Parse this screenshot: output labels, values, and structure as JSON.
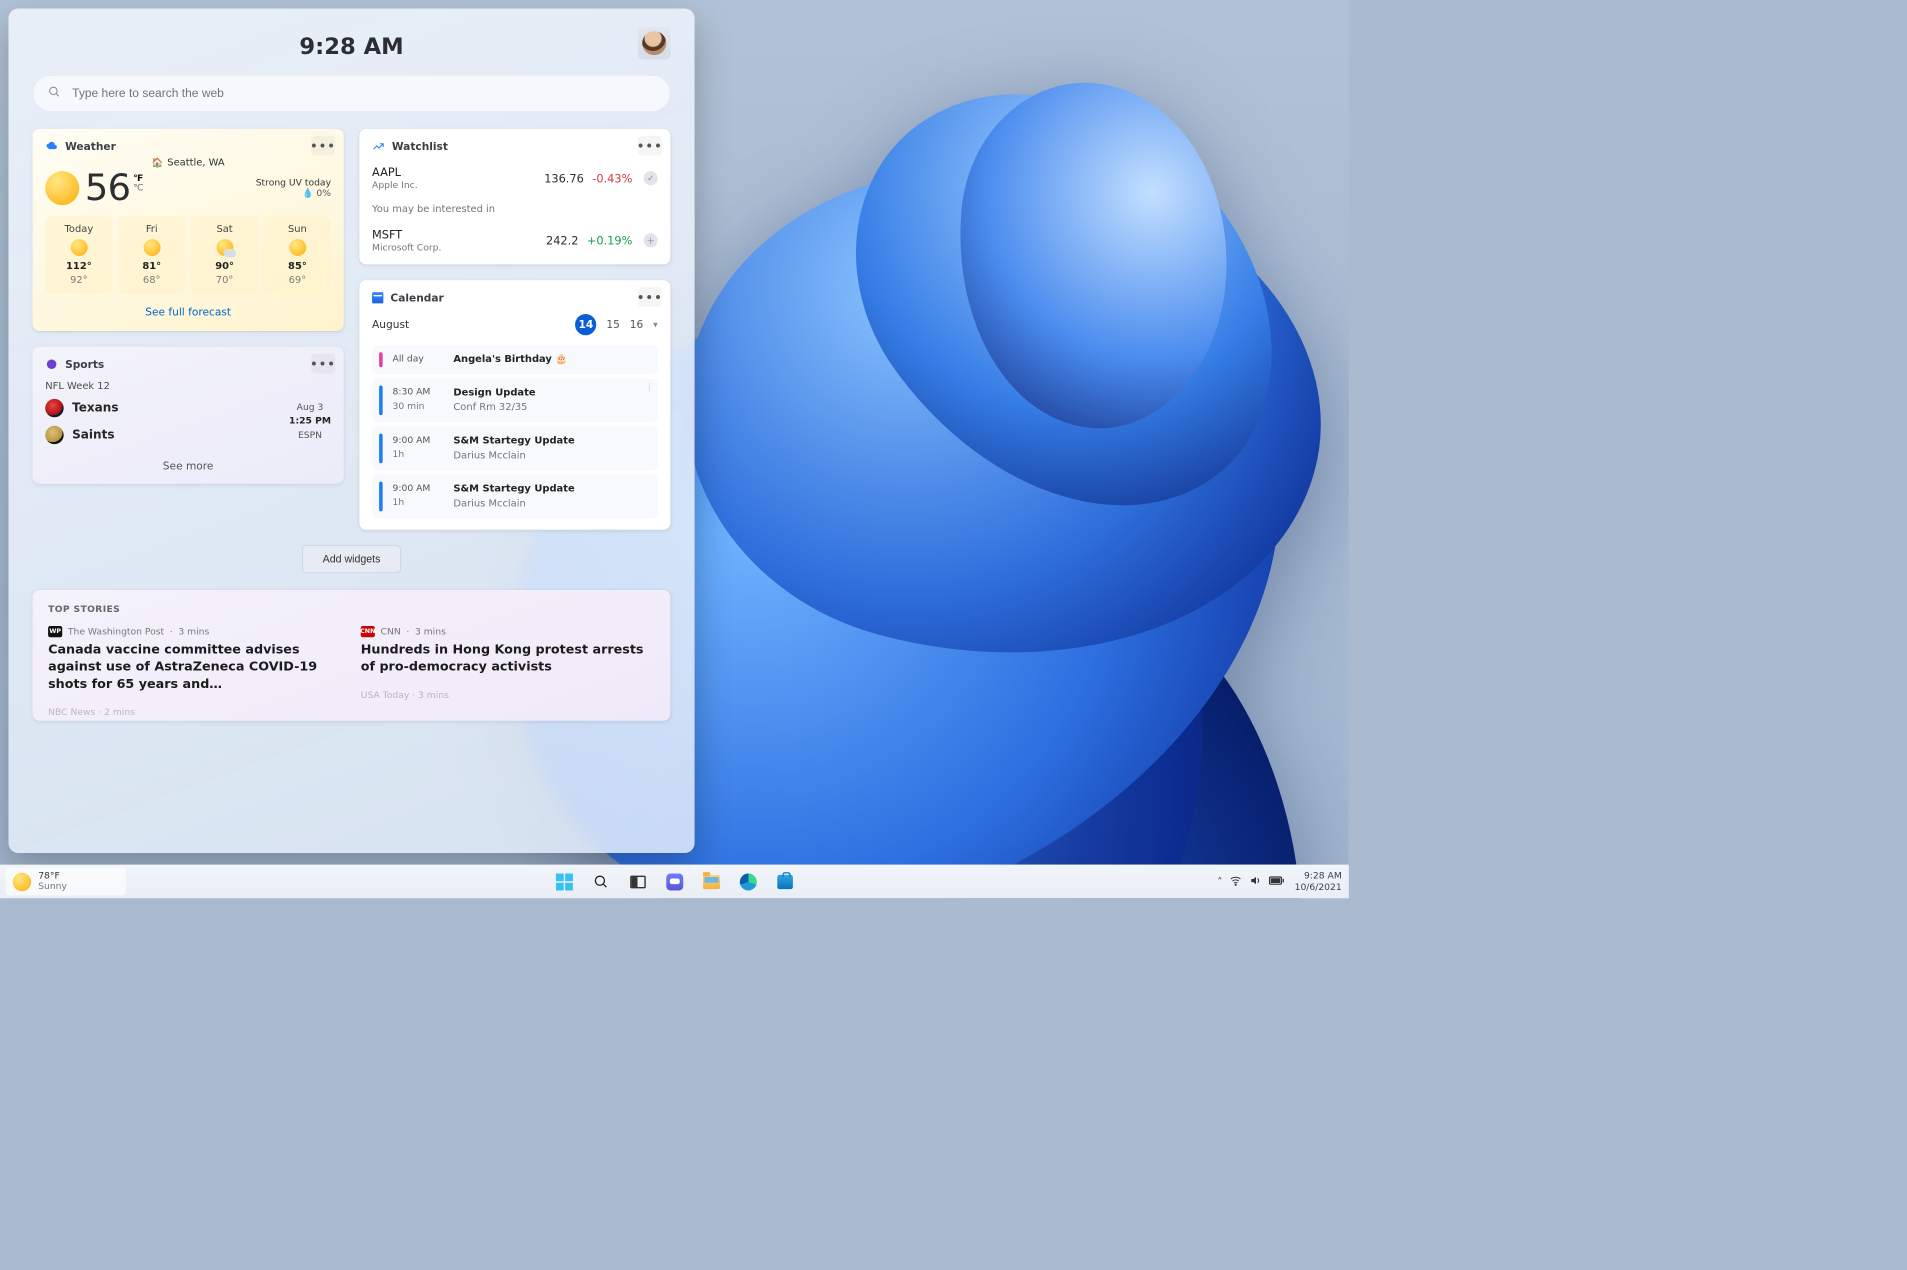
{
  "header": {
    "time": "9:28 AM"
  },
  "search": {
    "placeholder": "Type here to search the web"
  },
  "weather": {
    "title": "Weather",
    "location": "Seattle, WA",
    "temp": "56",
    "unit_f": "°F",
    "unit_c": "°C",
    "uv": "Strong UV today",
    "precip_icon": "💧",
    "precip": "0%",
    "days": [
      {
        "name": "Today",
        "hi": "112°",
        "lo": "92°"
      },
      {
        "name": "Fri",
        "hi": "81°",
        "lo": "68°"
      },
      {
        "name": "Sat",
        "hi": "90°",
        "lo": "70°"
      },
      {
        "name": "Sun",
        "hi": "85°",
        "lo": "69°"
      }
    ],
    "link": "See full forecast"
  },
  "watchlist": {
    "title": "Watchlist",
    "rows": [
      {
        "sym": "AAPL",
        "name": "Apple Inc.",
        "price": "136.76",
        "chg": "-0.43%",
        "dir": "neg"
      },
      {
        "sym": "MSFT",
        "name": "Microsoft Corp.",
        "price": "242.2",
        "chg": "+0.19%",
        "dir": "pos"
      }
    ],
    "note": "You may be interested in"
  },
  "sports": {
    "title": "Sports",
    "subtitle": "NFL Week 12",
    "teams": [
      {
        "name": "Texans"
      },
      {
        "name": "Saints"
      }
    ],
    "when_date": "Aug 3",
    "when_time": "1:25 PM",
    "when_net": "ESPN",
    "more": "See more"
  },
  "calendar": {
    "title": "Calendar",
    "month": "August",
    "dates": [
      "14",
      "15",
      "16"
    ],
    "events": [
      {
        "bar": "pink",
        "time": "All day",
        "dur": "",
        "title": "Angela's Birthday 🎂",
        "sub": ""
      },
      {
        "bar": "blue",
        "time": "8:30 AM",
        "dur": "30 min",
        "title": "Design Update",
        "sub": "Conf Rm 32/35"
      },
      {
        "bar": "blue",
        "time": "9:00 AM",
        "dur": "1h",
        "title": "S&M Startegy Update",
        "sub": "Darius Mcclain"
      },
      {
        "bar": "blue",
        "time": "9:00 AM",
        "dur": "1h",
        "title": "S&M Startegy Update",
        "sub": "Darius Mcclain"
      }
    ]
  },
  "add_widgets": "Add widgets",
  "news": {
    "heading": "TOP STORIES",
    "items": [
      {
        "src": "The Washington Post",
        "badge": "wapo",
        "badge_text": "WP",
        "age": "3 mins",
        "title": "Canada vaccine committee advises against use of AstraZeneca COVID-19 shots for 65 years and…"
      },
      {
        "src": "CNN",
        "badge": "cnn",
        "badge_text": "CNN",
        "age": "3 mins",
        "title": "Hundreds in Hong Kong protest arrests of pro-democracy activists"
      }
    ],
    "more_left": "NBC News · 2 mins",
    "more_right": "USA Today · 3 mins"
  },
  "taskbar": {
    "weather_temp": "78°F",
    "weather_cond": "Sunny",
    "time": "9:28 AM",
    "date": "10/6/2021"
  }
}
